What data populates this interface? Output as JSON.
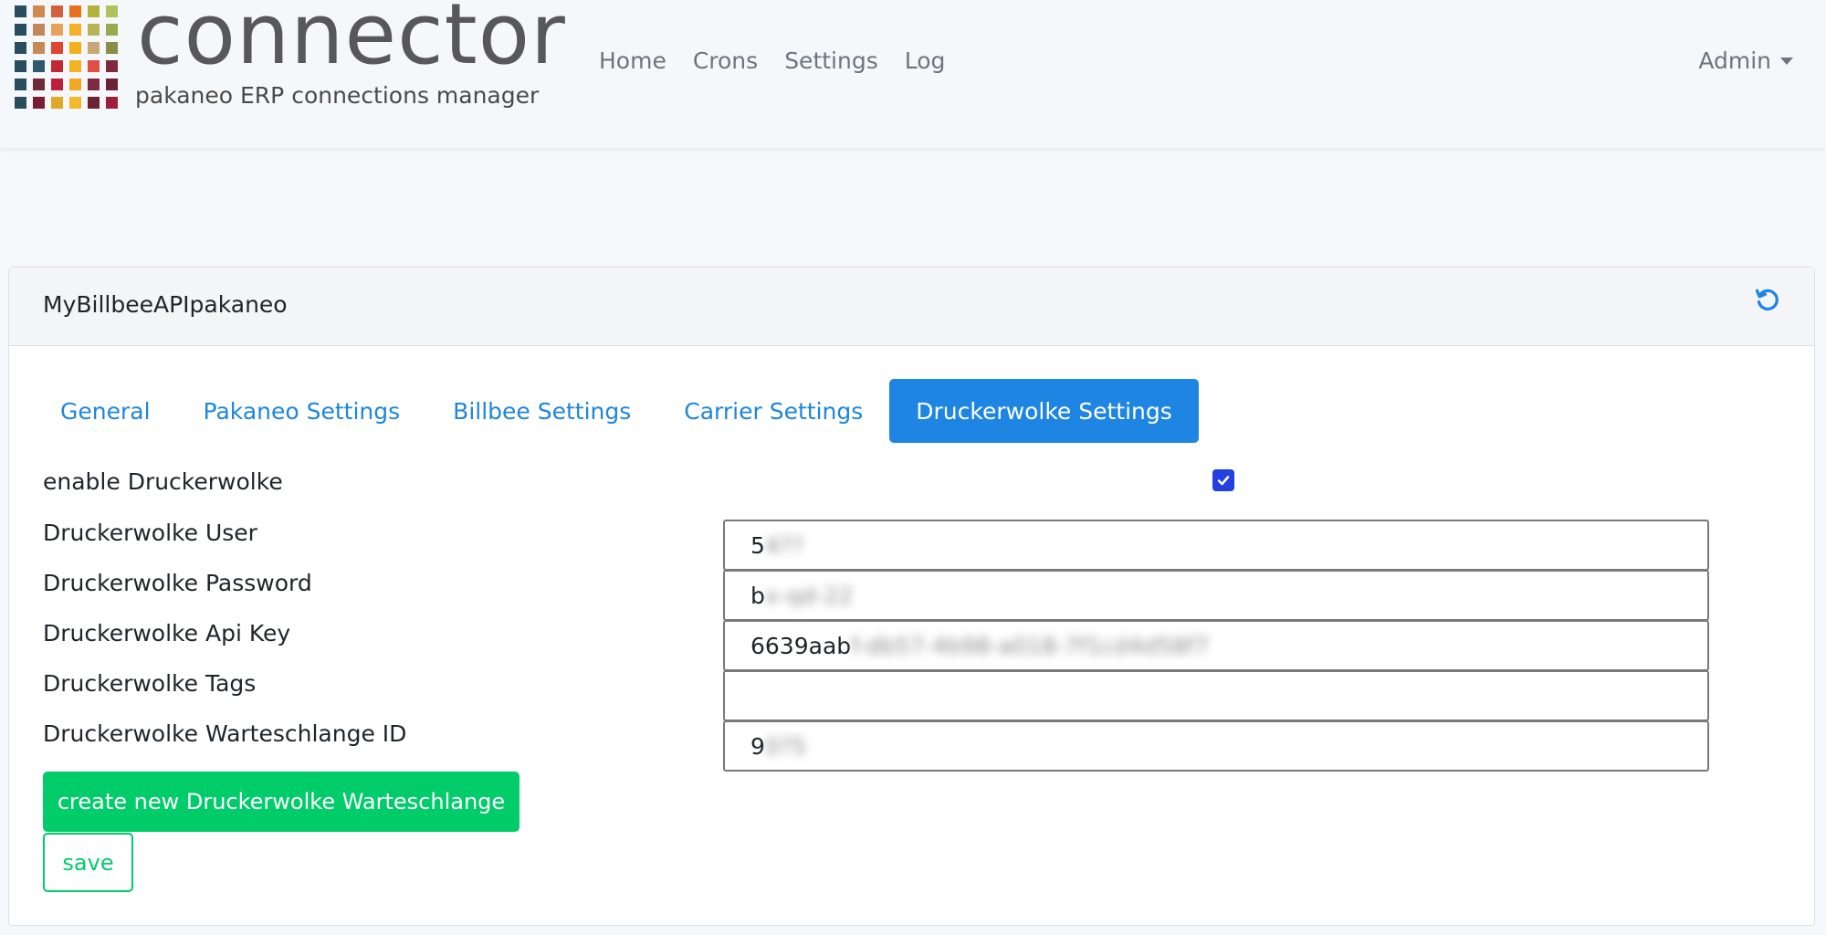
{
  "brand": {
    "title": "connector",
    "subtitle": "pakaneo ERP connections manager",
    "logo_colors": [
      [
        "#2a4d5e",
        "#cf8a52",
        "#d35f3c",
        "#e8701c",
        "#b0b43a",
        "#b2c25b"
      ],
      [
        "#2a4d5e",
        "#c3865a",
        "#e9a05b",
        "#f4b02a",
        "#b8b45b",
        "#9aa94d"
      ],
      [
        "#2a4d5e",
        "#c78a56",
        "#e0452f",
        "#f2b01b",
        "#c7a874",
        "#8a8f45"
      ],
      [
        "#2a4d5e",
        "#2f5a6b",
        "#c1282f",
        "#f3b424",
        "#e04e44",
        "#7e2b3c"
      ],
      [
        "#2a4d5e",
        "#6e2a3a",
        "#c01f3a",
        "#f2a825",
        "#7e2b41",
        "#6e2235"
      ],
      [
        "#2a4d5e",
        "#7a1d36",
        "#e0a824",
        "#f2b928",
        "#6c2230",
        "#9e1f3b"
      ]
    ]
  },
  "nav": {
    "links": [
      "Home",
      "Crons",
      "Settings",
      "Log"
    ],
    "user": "Admin"
  },
  "card": {
    "title": "MyBillbeeAPIpakaneo",
    "tabs": [
      "General",
      "Pakaneo Settings",
      "Billbee Settings",
      "Carrier Settings",
      "Druckerwolke Settings"
    ],
    "active_tab": "Druckerwolke Settings"
  },
  "form": {
    "enable_label": "enable Druckerwolke",
    "enable_checked": true,
    "fields": [
      {
        "label": "Druckerwolke User",
        "value": "5",
        "hidden": "4?? "
      },
      {
        "label": "Druckerwolke Password",
        "value": "b",
        "hidden": "x-qd-22"
      },
      {
        "label": "Druckerwolke Api Key",
        "value": "6639aab",
        "hidden": "f-db57-4b98-a018-7f1cd4d58f7"
      },
      {
        "label": "Druckerwolke Tags",
        "value": "",
        "hidden": ""
      },
      {
        "label": "Druckerwolke Warteschlange ID",
        "value": "9",
        "hidden": "0?5"
      }
    ],
    "create_button": "create new Druckerwolke Warteschlange",
    "save_button": "save"
  },
  "colors": {
    "primary": "#1e86e2",
    "success": "#00cc6a",
    "checkbox": "#2440e0"
  }
}
